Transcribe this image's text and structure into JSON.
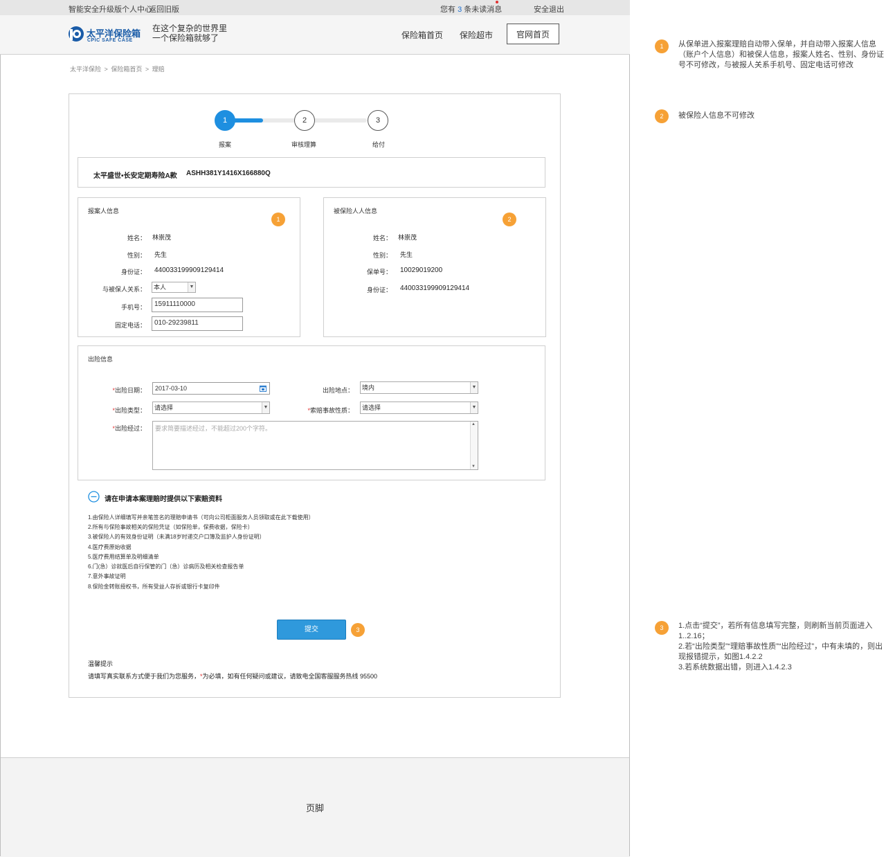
{
  "topbar": {
    "personal_center": "智能安全升级版个人中心",
    "back_old": "返回旧版",
    "msg_prefix": "您有",
    "msg_count": "3",
    "msg_suffix": "条未读消息",
    "logout": "安全退出"
  },
  "header": {
    "logo_cn": "太平洋保险箱",
    "logo_en": "CPIC SAFE CASE",
    "slogan_line1": "在这个复杂的世界里",
    "slogan_line2": "一个保险箱就够了",
    "nav": [
      "保险箱首页",
      "保险超市"
    ],
    "nav_official": "官网首页"
  },
  "breadcrumb": [
    "太平洋保险",
    ">",
    "保险箱首页",
    ">",
    "理赔"
  ],
  "steps": [
    {
      "num": "1",
      "label": "报案",
      "active": true
    },
    {
      "num": "2",
      "label": "审核理算",
      "active": false
    },
    {
      "num": "3",
      "label": "给付",
      "active": false
    }
  ],
  "policy": {
    "name": "太平盛世•长安定期寿险A款",
    "number": "ASHH381Y1416X166880Q"
  },
  "reporter": {
    "title": "报案人信息",
    "badge": "1",
    "rows": [
      {
        "label": "姓名：",
        "value": "林崇茂"
      },
      {
        "label": "性别：",
        "value": "先生"
      },
      {
        "label": "身份证：",
        "value": "440033199909129414"
      }
    ],
    "relation_label": "与被保人关系：",
    "relation_value": "本人",
    "phone_label": "手机号：",
    "phone_value": "15911110000",
    "tel_label": "固定电话：",
    "tel_value": "010-29239811"
  },
  "insured": {
    "title": "被保险人人信息",
    "badge": "2",
    "rows": [
      {
        "label": "姓名：",
        "value": "林崇茂"
      },
      {
        "label": "性别：",
        "value": "先生"
      },
      {
        "label": "保单号：",
        "value": "10029019200"
      },
      {
        "label": "身份证：",
        "value": "440033199909129414"
      }
    ]
  },
  "accident": {
    "title": "出险信息",
    "star": "*",
    "date_label": "出险日期：",
    "date_value": "2017-03-10",
    "place_label": "出险地点：",
    "place_value": "境内",
    "type_label": "出险类型：",
    "type_value": "请选择",
    "nature_label": "索赔事故性质：",
    "nature_value": "请选择",
    "desc_label": "出险经过：",
    "desc_placeholder": "要求简要描述经过，不能超过200个字符。"
  },
  "materials": {
    "title": "请在申请本案理赔时提供以下索赔资料",
    "items": [
      "1.由保险人详细填写并亲笔签名的理赔申请书（可向公司柜面服务人员领取或在此下载使用）",
      "2.所有与保险事故相关的保险凭证（如保险单，保费收据，保险卡）",
      "3.被保险人的有效身份证明（未满18岁时递交户口簿及监护人身份证明）",
      "4.医疗费原始收据",
      "5.医疗费用结算单及明细清单",
      "6.门(急）诊就医后自行保管的门（急）诊病历及相关检查报告单",
      "7.意外事故证明",
      "8.保险金转账授权书，所有受益人存折或银行卡复印件"
    ]
  },
  "submit": {
    "label": "提交",
    "badge": "3"
  },
  "tips": {
    "title": "温馨提示",
    "text_before": "请填写真实联系方式便于我们为您服务，",
    "star": "*",
    "text_after": "为必填，如有任何疑问或建议，请致电全国客服服务热线 95500"
  },
  "footer": {
    "label": "页脚"
  },
  "annotations": [
    {
      "badge": "1",
      "text": "从保单进入报案理赔自动带入保单，并自动带入报案人信息（账户个人信息）和被保人信息，报案人姓名、性别、身份证号不可修改，与被报人关系手机号、固定电话可修改"
    },
    {
      "badge": "2",
      "text": "被保险人信息不可修改"
    },
    {
      "badge": "3",
      "lines": [
        "1.点击“提交”，若所有信息填写完整，则刷新当前页面进入1..2.16；",
        "2.若“出险类型”“理赔事故性质”“出险经过”，中有未填的，则出现报错提示，如图1.4.2.2",
        "3.若系统数据出错，则进入1.4.2.3"
      ]
    }
  ],
  "colors": {
    "accent": "#1e8fe0",
    "submit": "#2f99dc",
    "badge": "#f6a136",
    "logo": "#1a5ca8"
  }
}
